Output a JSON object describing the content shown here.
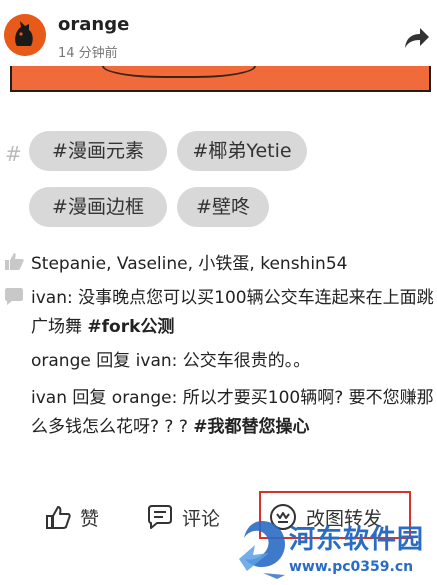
{
  "post": {
    "username": "orange",
    "time": "14 分钟前"
  },
  "tags": {
    "items": [
      "#漫画元素",
      "#椰弟Yetie",
      "#漫画边框",
      "#壁咚"
    ]
  },
  "likes": {
    "names": "Stepanie, Vaseline, 小铁蛋, kenshin54"
  },
  "comments": [
    {
      "author": "ivan",
      "sep": ": ",
      "text": "没事晚点您可以买100辆公交车连起来在上面跳广场舞 ",
      "tag": "#fork公测"
    },
    {
      "author": "orange",
      "reply": " 回复 ",
      "to": "ivan",
      "sep": ": ",
      "text": "公交车很贵的。。"
    },
    {
      "author": "ivan",
      "reply": " 回复 ",
      "to": "orange",
      "sep": ": ",
      "text": "所以才要买100辆啊? 要不您赚那么多钱怎么花呀? ? ? ",
      "tag": "#我都替您操心"
    }
  ],
  "actions": {
    "like": "赞",
    "comment": "评论",
    "repost": "改图转发"
  },
  "watermark": {
    "title": "河东软件园",
    "url": "www.pc0359.cn"
  },
  "colors": {
    "avatar": "#e85a1a",
    "image_bg": "#f06a3a",
    "tag_bg": "#d8d8d8",
    "highlight": "#d9322a",
    "watermark": "#2a6cc4"
  }
}
